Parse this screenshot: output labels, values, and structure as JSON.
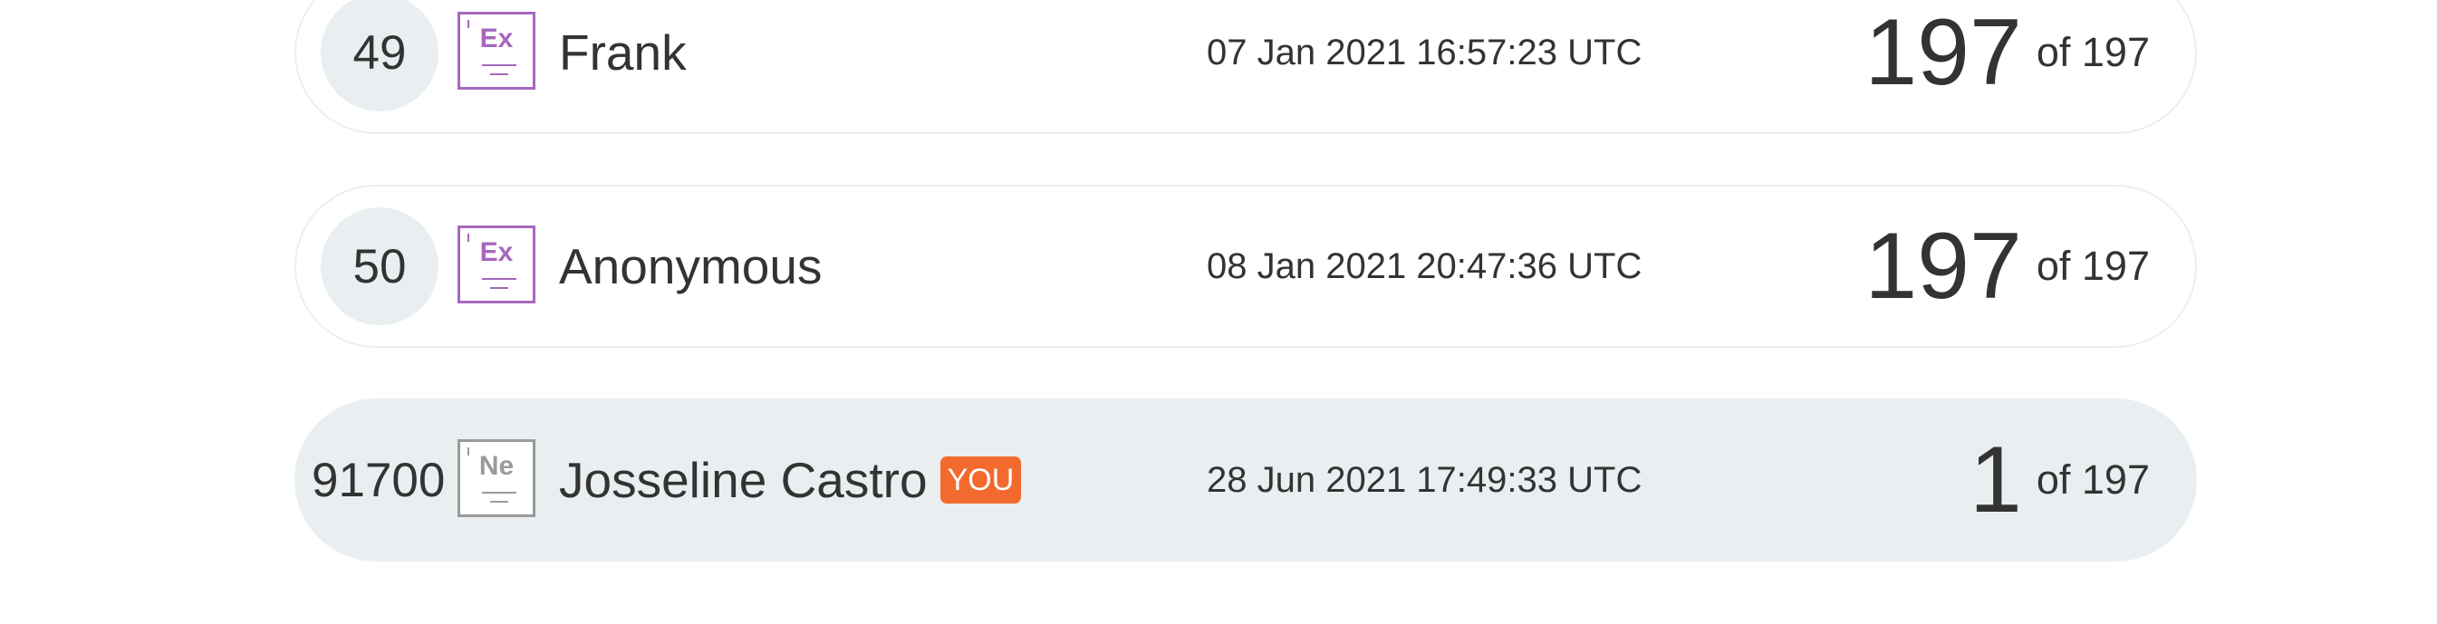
{
  "leaderboard": {
    "rows": [
      {
        "rank": "49",
        "badge_symbol": "Ex",
        "name": "Frank",
        "date": "07 Jan 2021 16:57:23 UTC",
        "score": "197",
        "of_total": "of 197"
      },
      {
        "rank": "50",
        "badge_symbol": "Ex",
        "name": "Anonymous",
        "date": "08 Jan 2021 20:47:36 UTC",
        "score": "197",
        "of_total": "of 197"
      },
      {
        "rank": "91700",
        "badge_symbol": "Ne",
        "name": "Josseline Castro",
        "you_label": "YOU",
        "date": "28 Jun 2021 17:49:33 UTC",
        "score": "1",
        "of_total": "of 197"
      }
    ]
  },
  "colors": {
    "badge_expert": "#a667bd",
    "badge_newbie": "#9a9a9a",
    "you_badge": "#f26a2e",
    "current_user_row": "#e9eef0"
  }
}
